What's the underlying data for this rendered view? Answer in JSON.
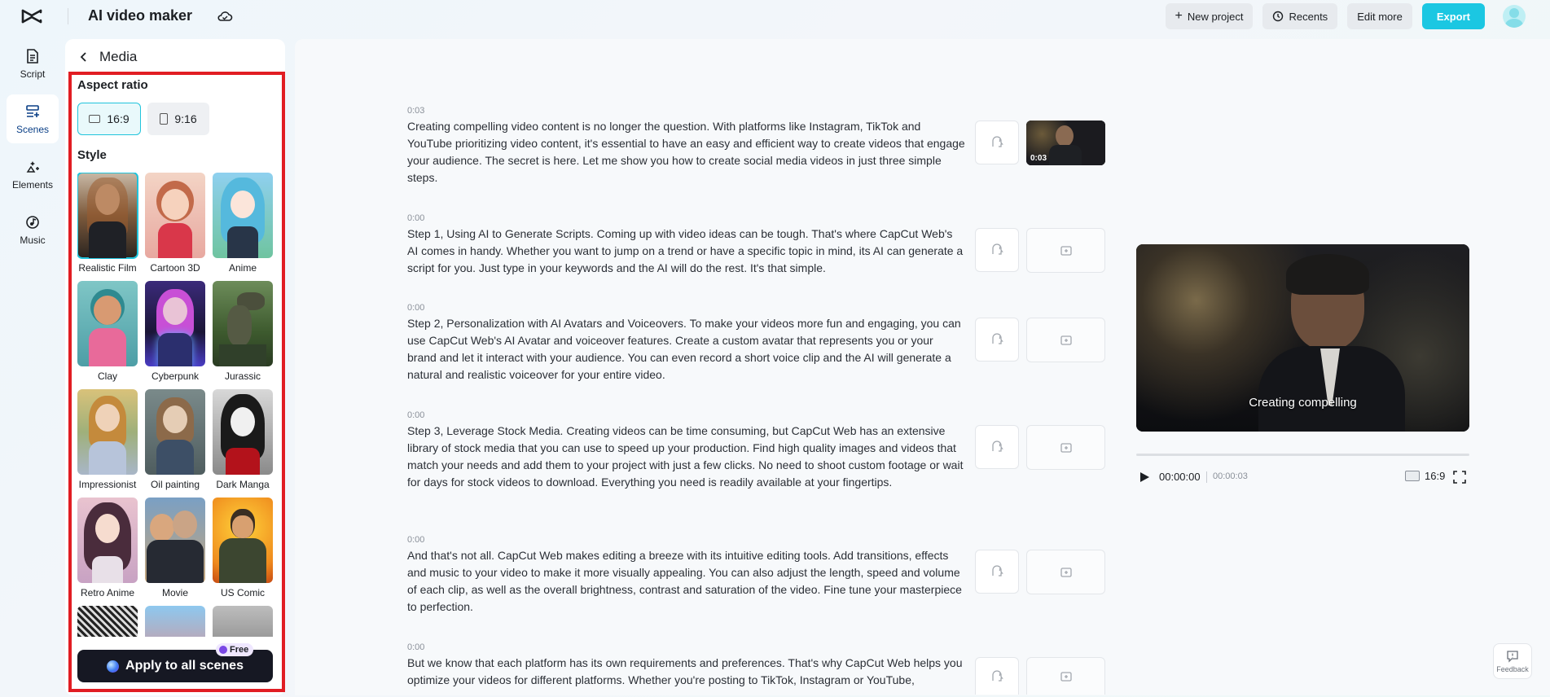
{
  "app": {
    "title": "AI video maker"
  },
  "toolbar": {
    "new_project": "New project",
    "recents": "Recents",
    "edit_more": "Edit more",
    "export": "Export"
  },
  "nav": {
    "items": [
      {
        "label": "Script",
        "icon": "script-icon"
      },
      {
        "label": "Scenes",
        "icon": "scenes-icon",
        "active": true
      },
      {
        "label": "Elements",
        "icon": "elements-icon"
      },
      {
        "label": "Music",
        "icon": "music-icon"
      }
    ]
  },
  "media_panel": {
    "title": "Media",
    "aspect_label": "Aspect ratio",
    "aspect_options": [
      "16:9",
      "9:16"
    ],
    "aspect_selected": "16:9",
    "style_label": "Style",
    "styles": [
      "Realistic Film",
      "Cartoon 3D",
      "Anime",
      "Clay",
      "Cyberpunk",
      "Jurassic",
      "Impressionist",
      "Oil painting",
      "Dark Manga",
      "Retro Anime",
      "Movie",
      "US Comic"
    ],
    "style_selected": "Realistic Film",
    "apply_label": "Apply to all scenes",
    "free_badge": "Free"
  },
  "scenes": [
    {
      "time": "0:03",
      "text": "Creating compelling video content is no longer the question. With platforms like Instagram, TikTok and YouTube prioritizing video content, it's essential to have an easy and efficient way to create videos that engage your audience. The secret is here. Let me show you how to create social media videos in just three simple steps.",
      "media_time": "0:03"
    },
    {
      "time": "0:00",
      "text": "Step 1, Using AI to Generate Scripts. Coming up with video ideas can be tough. That's where CapCut Web's AI comes in handy. Whether you want to jump on a trend or have a specific topic in mind, its AI can generate a script for you. Just type in your keywords and the AI will do the rest. It's that simple."
    },
    {
      "time": "0:00",
      "text": "Step 2, Personalization with AI Avatars and Voiceovers. To make your videos more fun and engaging, you can use CapCut Web's AI Avatar and voiceover features. Create a custom avatar that represents you or your brand and let it interact with your audience. You can even record a short voice clip and the AI will generate a natural and realistic voiceover for your entire video."
    },
    {
      "time": "0:00",
      "text": "Step 3, Leverage Stock Media. Creating videos can be time consuming, but CapCut Web has an extensive library of stock media that you can use to speed up your production. Find high quality images and videos that match your needs and add them to your project with just a few clicks. No need to shoot custom footage or wait for days for stock videos to download. Everything you need is readily available at your fingertips."
    },
    {
      "time": "0:00",
      "text": "And that's not all. CapCut Web makes editing a breeze with its intuitive editing tools. Add transitions, effects and music to your video to make it more visually appealing. You can also adjust the length, speed and volume of each clip, as well as the overall brightness, contrast and saturation of the video. Fine tune your masterpiece to perfection."
    },
    {
      "time": "0:00",
      "text": "But we know that each platform has its own requirements and preferences. That's why CapCut Web helps you optimize your videos for different platforms. Whether you're posting to TikTok, Instagram or YouTube,"
    }
  ],
  "preview": {
    "caption": "Creating compelling",
    "current_time": "00:00:00",
    "total_time": "00:00:03",
    "ratio": "16:9",
    "progress": 0
  },
  "feedback": {
    "label": "Feedback"
  },
  "colors": {
    "accent": "#1bc7e2",
    "highlight_frame": "#e11d23",
    "apply_button": "#161823"
  }
}
